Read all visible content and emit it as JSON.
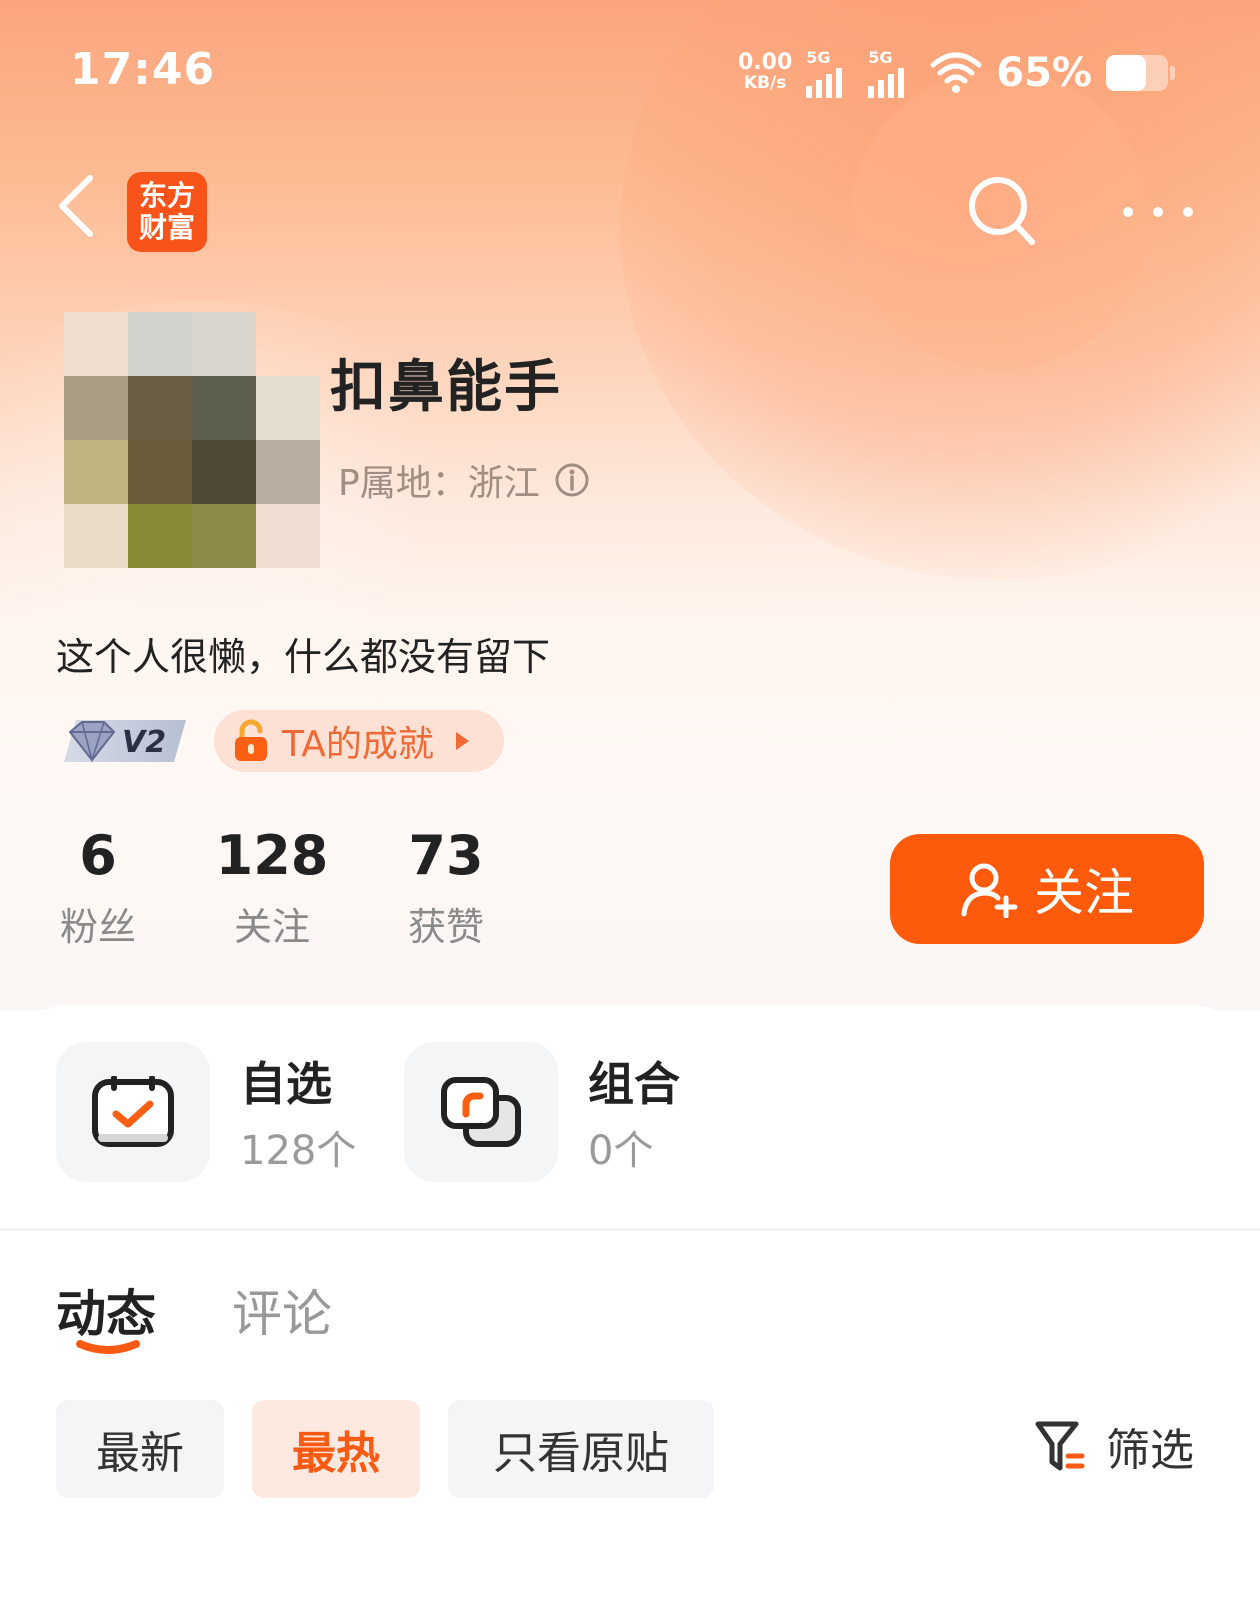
{
  "status_bar": {
    "time": "17:46",
    "net_speed_value": "0.00",
    "net_speed_unit": "KB/s",
    "sim1": "5G",
    "sim2": "5G",
    "battery_percent": "65%"
  },
  "nav": {
    "logo_line1": "东方",
    "logo_line2": "财富",
    "icons": [
      "back-arrow-icon",
      "search-icon",
      "more-icon"
    ]
  },
  "profile": {
    "nickname": "扣鼻能手",
    "ip_location": "P属地：浙江",
    "bio": "这个人很懒，什么都没有留下",
    "level": "V2",
    "achievement": "TA的成就"
  },
  "stats": [
    {
      "value": "6",
      "label": "粉丝"
    },
    {
      "value": "128",
      "label": "关注"
    },
    {
      "value": "73",
      "label": "获赞"
    }
  ],
  "follow_button": "关注",
  "collections": [
    {
      "title": "自选",
      "count": "128个",
      "icon": "checkbox-icon"
    },
    {
      "title": "组合",
      "count": "0个",
      "icon": "portfolio-icon"
    }
  ],
  "tabs": [
    {
      "label": "动态",
      "active": true
    },
    {
      "label": "评论",
      "active": false
    }
  ],
  "filters": [
    {
      "label": "最新",
      "active": false
    },
    {
      "label": "最热",
      "active": true
    },
    {
      "label": "只看原贴",
      "active": false
    }
  ],
  "filter_button": "筛选",
  "colors": {
    "accent": "#fd5a0b",
    "accent_light": "#fde9df",
    "header_top": "#fba57e",
    "text_primary": "#222222",
    "text_secondary": "#999999"
  }
}
